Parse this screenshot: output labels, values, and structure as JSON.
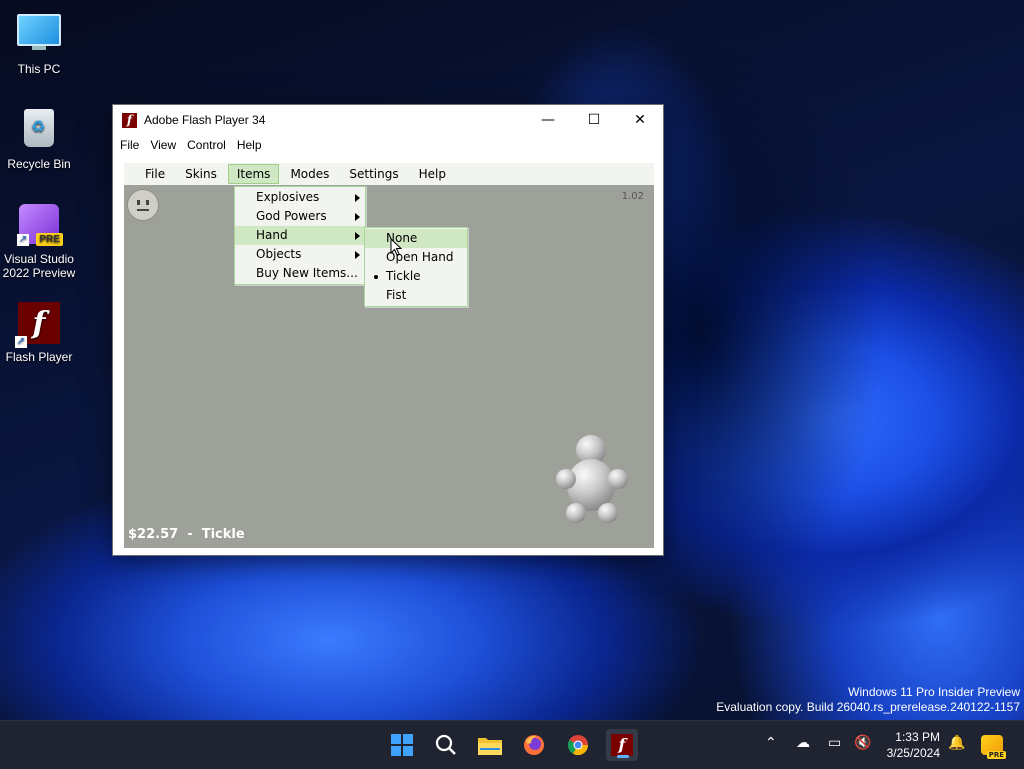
{
  "desktop": {
    "icons": [
      {
        "label": "This PC"
      },
      {
        "label": "Recycle Bin"
      },
      {
        "label_line1": "Visual Studio",
        "label_line2": "2022 Preview",
        "badge": "PRE"
      },
      {
        "label": "Flash Player"
      }
    ]
  },
  "window": {
    "title": "Adobe Flash Player 34",
    "controls": {
      "minimize": "—",
      "maximize": "☐",
      "close": "✕"
    },
    "menu": [
      "File",
      "View",
      "Control",
      "Help"
    ]
  },
  "game": {
    "menu": [
      "File",
      "Skins",
      "Items",
      "Modes",
      "Settings",
      "Help"
    ],
    "active_menu": "Items",
    "version": "1.02",
    "status_money": "$22.57",
    "status_separator": "-",
    "status_tool": "Tickle",
    "items_menu": [
      "Explosives",
      "God Powers",
      "Hand",
      "Objects",
      "Buy New Items..."
    ],
    "items_highlighted": "Hand",
    "hand_submenu": [
      "None",
      "Open Hand",
      "Tickle",
      "Fist"
    ],
    "hand_highlighted": "None",
    "hand_selected": "Tickle",
    "colors": {
      "stage": "#9ea19a",
      "menu_bg": "#f2f4ef",
      "highlight": "#cfe8c3",
      "menu_border": "#a9d79a"
    }
  },
  "watermark": {
    "line1": "Windows 11 Pro Insider Preview",
    "line2": "Evaluation copy. Build 26040.rs_prerelease.240122-1157"
  },
  "taskbar": {
    "apps": [
      "start-icon",
      "search-icon",
      "file-explorer-icon",
      "firefox-icon",
      "chrome-icon",
      "flash-player-icon"
    ],
    "time": "1:33 PM",
    "date": "3/25/2024",
    "copilot_badge": "PRE"
  }
}
